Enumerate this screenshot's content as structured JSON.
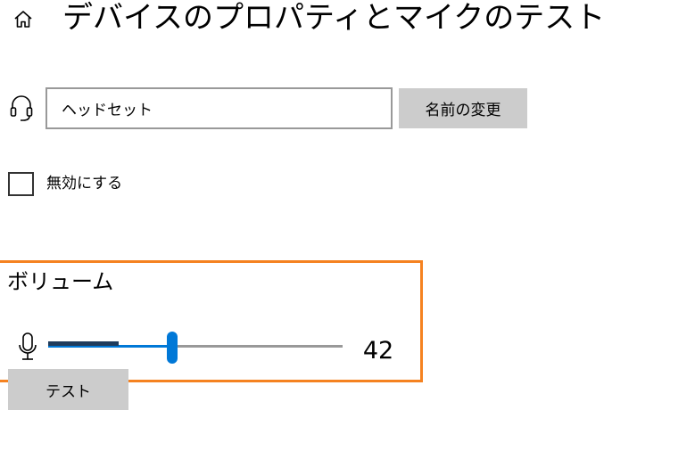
{
  "header": {
    "home_icon": "home-icon",
    "title": "デバイスのプロパティとマイクのテスト"
  },
  "device": {
    "icon": "headset-icon",
    "name_value": "ヘッドセット",
    "rename_label": "名前の変更"
  },
  "disable": {
    "checked": false,
    "label": "無効にする"
  },
  "volume": {
    "heading": "ボリューム",
    "icon": "microphone-icon",
    "value": 42,
    "value_text": "42",
    "input_level_fraction": 0.24
  },
  "test": {
    "label": "テスト"
  },
  "colors": {
    "accent": "#0078d7",
    "highlight": "#f58220",
    "button_bg": "#cccccc"
  }
}
